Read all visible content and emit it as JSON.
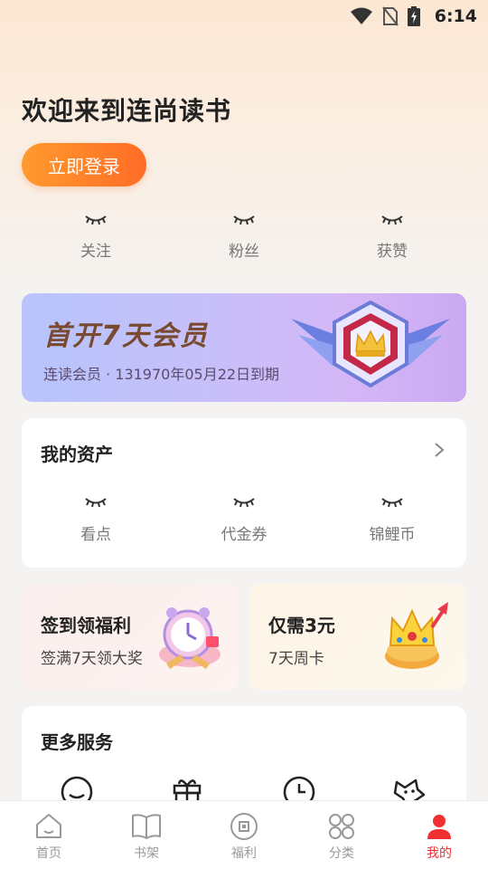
{
  "status_bar": {
    "time": "6:14"
  },
  "header": {
    "welcome": "欢迎来到连尚读书",
    "login_label": "立即登录"
  },
  "social_stats": [
    {
      "label": "关注"
    },
    {
      "label": "粉丝"
    },
    {
      "label": "获赞"
    }
  ],
  "vip_banner": {
    "title": "首开7天会员",
    "subtitle": "连读会员 · 131970年05月22日到期"
  },
  "assets": {
    "title": "我的资产",
    "items": [
      {
        "label": "看点"
      },
      {
        "label": "代金券"
      },
      {
        "label": "锦鲤币"
      }
    ]
  },
  "promos": {
    "sign_in": {
      "title": "签到领福利",
      "subtitle": "签满7天领大奖"
    },
    "weekly_card": {
      "title": "仅需3元",
      "subtitle": "7天周卡"
    }
  },
  "services": {
    "title": "更多服务"
  },
  "bottom_nav": {
    "items": [
      {
        "label": "首页",
        "icon": "home-icon"
      },
      {
        "label": "书架",
        "icon": "bookshelf-icon"
      },
      {
        "label": "福利",
        "icon": "welfare-icon"
      },
      {
        "label": "分类",
        "icon": "category-icon"
      },
      {
        "label": "我的",
        "icon": "profile-icon",
        "active": true
      }
    ]
  },
  "colors": {
    "accent_orange": "#ff7a28",
    "active_nav": "#f03030",
    "vip_title": "#7a4a30"
  }
}
